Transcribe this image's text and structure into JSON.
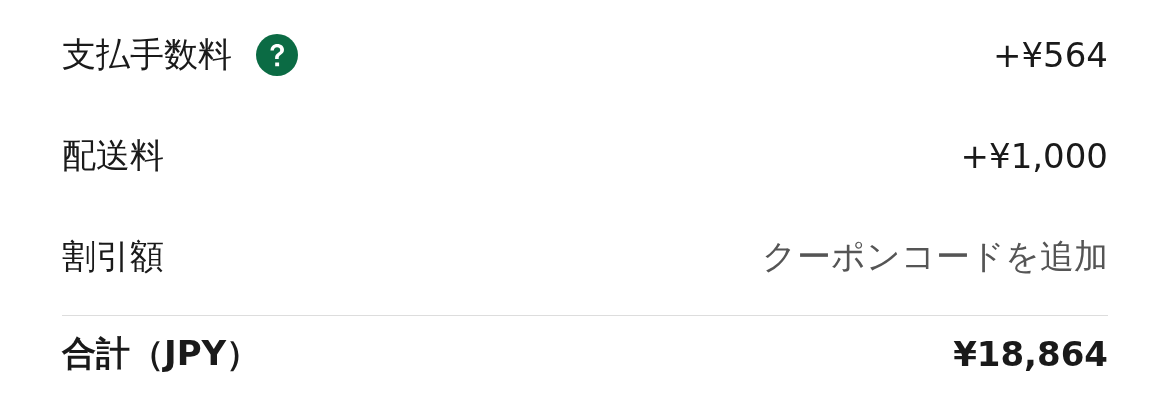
{
  "rows": [
    {
      "label": "支払手数料",
      "help": true,
      "kind": "amount",
      "value": "+¥564"
    },
    {
      "label": "配送料",
      "help": false,
      "kind": "amount",
      "value": "+¥1,000"
    },
    {
      "label": "割引額",
      "help": false,
      "kind": "link",
      "value": "クーポンコードを追加"
    }
  ],
  "total": {
    "label": "合計（JPY）",
    "value": "¥18,864"
  }
}
